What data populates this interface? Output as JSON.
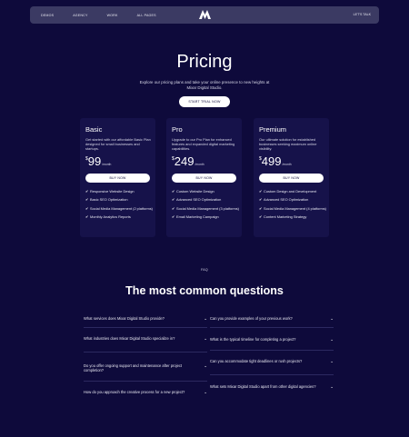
{
  "nav": {
    "links": [
      "DEMOS",
      "AGENCY",
      "WORK",
      "ALL PAGES"
    ],
    "logo_icon": "m-brand-logo-icon",
    "cta": "LET'S TALK"
  },
  "hero": {
    "title": "Pricing",
    "subtitle": "Explore our pricing plans and take your online presence to new heights at Mixar Digital Studio.",
    "button": "START TRIAL NOW"
  },
  "plans": [
    {
      "name": "Basic",
      "description": "Get started with our affordable Basic Plan designed for small businesses and startups.",
      "currency": "$",
      "price": "99",
      "period": "/month",
      "button": "BUY NOW",
      "features": [
        "Responsive Website Design",
        "Basic SEO Optimization",
        "Social Media Management (2 platforms)",
        "Monthly Analytics Reports"
      ]
    },
    {
      "name": "Pro",
      "description": "Upgrade to our Pro Plan for enhanced features and expanded digital marketing capabilities.",
      "currency": "$",
      "price": "249",
      "period": "/month",
      "button": "BUY NOW",
      "features": [
        "Custom Website Design",
        "Advanced SEO Optimization",
        "Social Media Management (3 platforms)",
        "Email Marketing Campaign"
      ]
    },
    {
      "name": "Premium",
      "description": "Our ultimate solution for established businesses seeking maximum online visibility.",
      "currency": "$",
      "price": "499",
      "period": "/month",
      "button": "BUY NOW",
      "features": [
        "Custom Design and Development",
        "Advanced SEO Optimization",
        "Social Media Management (4 platforms)",
        "Content Marketing Strategy"
      ]
    }
  ],
  "faq": {
    "tag": "FAQ",
    "title": "The most common questions",
    "left": [
      "What services does Mixar Digital Studio provide?",
      "What industries does Mixar Digital Studio specialize in?",
      "Do you offer ongoing support and maintenance after project completion?",
      "How do you approach the creative process for a new project?"
    ],
    "right": [
      "Can you provide examples of your previous work?",
      "What is the typical timeline for completing a project?",
      "Can you accommodate tight deadlines or rush projects?",
      "What sets Mixar Digital Studio apart from other digital agencies?"
    ],
    "chevron_icon": "chevron-down-icon"
  },
  "colors": {
    "background": "#0e0a3b",
    "nav_bg": "#3b3a63",
    "card_bg": "#16124a",
    "button_bg": "#ffffff"
  }
}
